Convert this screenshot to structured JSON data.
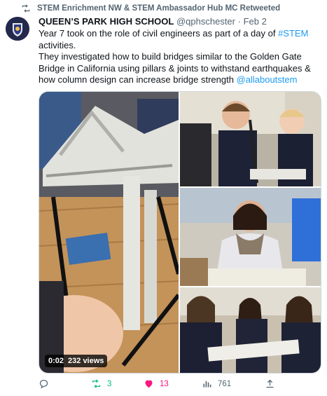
{
  "retweet_bar": {
    "text": "STEM Enrichment NW & STEM Ambassador Hub MC Retweeted"
  },
  "tweet": {
    "author_name": "QUEEN’S PARK HIGH SCHOOL",
    "handle": "@qphschester",
    "separator": "·",
    "date": "Feb 2",
    "line1_prefix": "Year 7 took on the role of civil engineers as part of a day of ",
    "hashtag": "#STEM",
    "line1_suffix": " activities.",
    "line2": "They investigated how to build bridges similar to the Golden Gate Bridge in California using pillars & joints to withstand earthquakes & how column design can increase bridge strength  ",
    "mention": "@allaboutstem"
  },
  "media": {
    "video_time": "0:02",
    "video_views": "232 views"
  },
  "actions": {
    "reply_count": "",
    "retweet_count": "3",
    "like_count": "13",
    "view_count": "761"
  },
  "colors": {
    "accent": "#1d9bf0",
    "retweet": "#00ba7c",
    "like": "#f91880",
    "muted": "#536471"
  }
}
